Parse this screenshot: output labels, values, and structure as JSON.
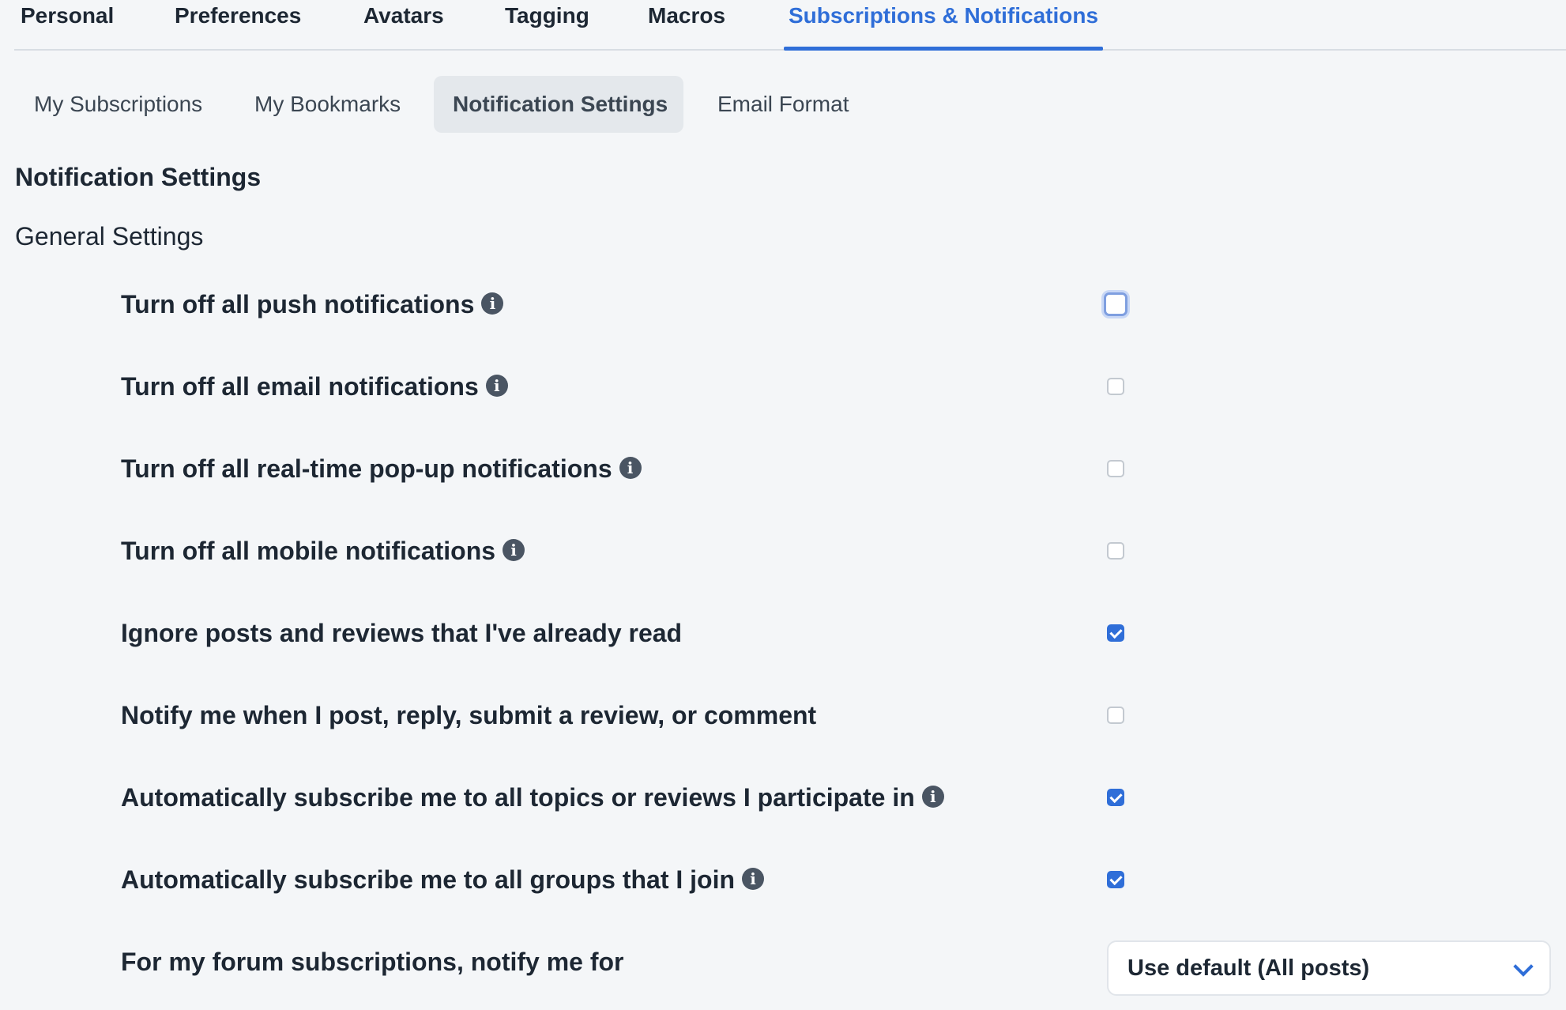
{
  "top_tabs": [
    {
      "label": "Personal"
    },
    {
      "label": "Preferences"
    },
    {
      "label": "Avatars"
    },
    {
      "label": "Tagging"
    },
    {
      "label": "Macros"
    },
    {
      "label": "Subscriptions & Notifications",
      "active": true
    }
  ],
  "sub_tabs": [
    {
      "label": "My Subscriptions"
    },
    {
      "label": "My Bookmarks"
    },
    {
      "label": "Notification Settings",
      "active": true
    },
    {
      "label": "Email Format"
    }
  ],
  "page_title": "Notification Settings",
  "section_title": "General Settings",
  "settings": [
    {
      "label": "Turn off all push notifications",
      "info": true,
      "checked": false
    },
    {
      "label": "Turn off all email notifications",
      "info": true,
      "checked": false
    },
    {
      "label": "Turn off all real-time pop-up notifications",
      "info": true,
      "checked": false
    },
    {
      "label": "Turn off all mobile notifications",
      "info": true,
      "checked": false
    },
    {
      "label": "Ignore posts and reviews that I've already read",
      "info": false,
      "checked": true
    },
    {
      "label": "Notify me when I post, reply, submit a review, or comment",
      "info": false,
      "checked": false
    },
    {
      "label": "Automatically subscribe me to all topics or reviews I participate in",
      "info": true,
      "checked": true
    },
    {
      "label": "Automatically subscribe me to all groups that I join",
      "info": true,
      "checked": true
    }
  ],
  "forum_notify": {
    "label": "For my forum subscriptions, notify me for",
    "selected": "Use default (All posts)"
  },
  "colors": {
    "accent": "#2f6ed8",
    "background": "#f4f6f8",
    "text": "#1d2733"
  },
  "icons": {
    "info": "info-circle-icon",
    "dropdown": "chevron-down-icon"
  }
}
